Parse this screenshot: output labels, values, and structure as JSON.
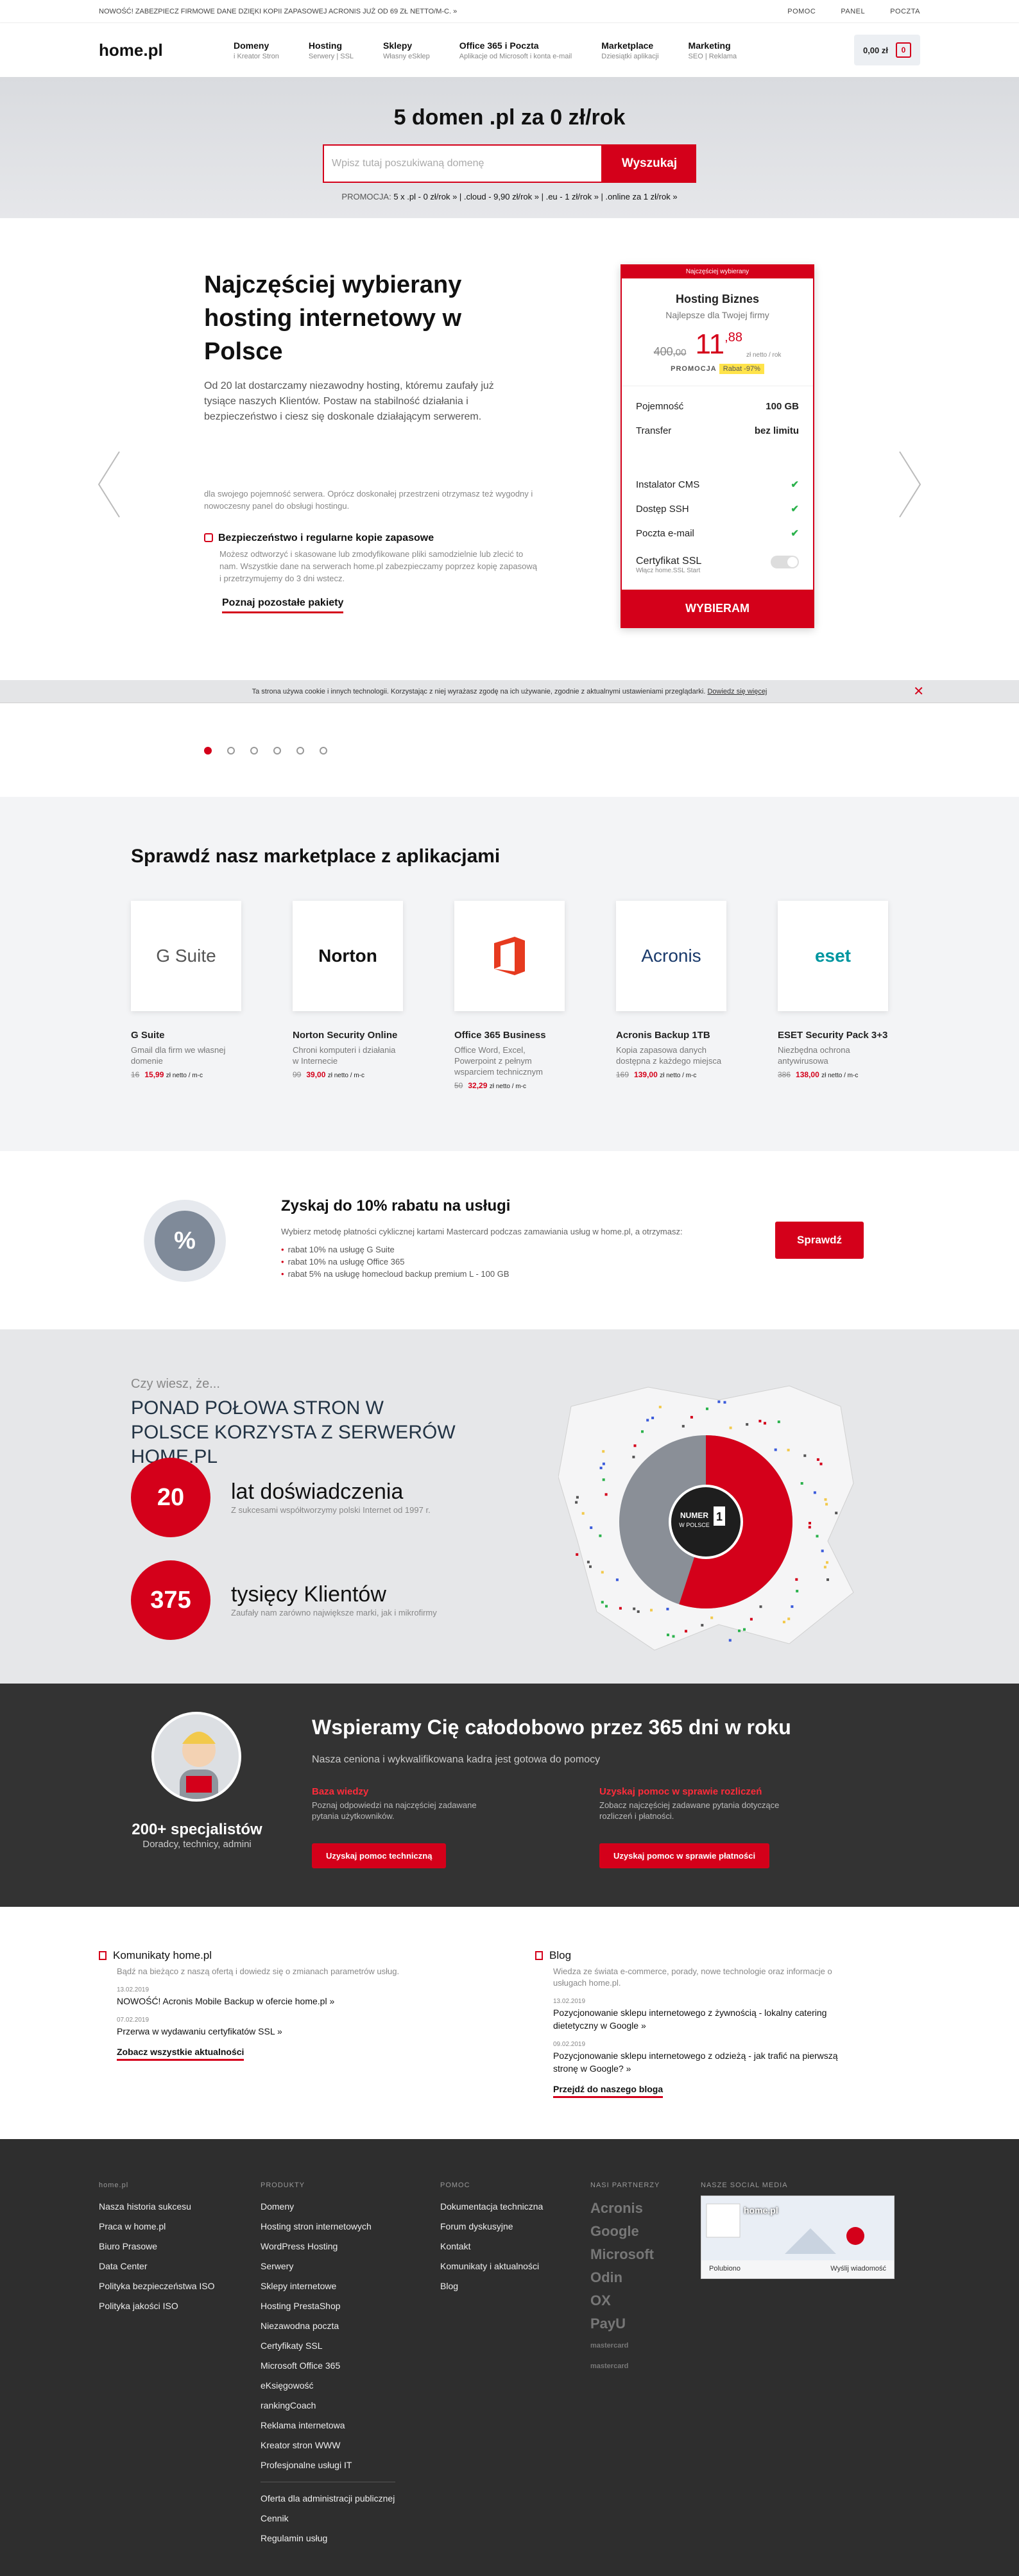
{
  "topbar": {
    "notice": "NOWOŚĆ! ZABEZPIECZ FIRMOWE DANE DZIĘKI KOPII ZAPASOWEJ ACRONIS JUŻ OD 69 ZŁ NETTO/M-C. »",
    "links": [
      "POMOC",
      "PANEL",
      "POCZTA"
    ]
  },
  "header": {
    "logo": "home.pl",
    "nav": [
      {
        "title": "Domeny",
        "sub": "i Kreator Stron"
      },
      {
        "title": "Hosting",
        "sub": "Serwery | SSL"
      },
      {
        "title": "Sklepy",
        "sub": "Własny eSklep"
      },
      {
        "title": "Office 365 i Poczta",
        "sub": "Aplikacje od Microsoft i konta e-mail"
      },
      {
        "title": "Marketplace",
        "sub": "Dziesiątki aplikacji"
      },
      {
        "title": "Marketing",
        "sub": "SEO | Reklama"
      }
    ],
    "cart": "0,00 zł",
    "cart_count": "0"
  },
  "hero": {
    "title": "5 domen .pl za 0 zł/rok",
    "placeholder": "Wpisz tutaj poszukiwaną domenę",
    "button": "Wyszukaj",
    "promo_label": "PROMOCJA:",
    "promo": "5 x .pl - 0 zł/rok » | .cloud - 9,90 zł/rok » | .eu - 1 zł/rok » | .online za 1 zł/rok »"
  },
  "hosting": {
    "title": "Najczęściej wybierany hosting internetowy w Polsce",
    "lead": "Od 20 lat dostarczamy niezawodny hosting, któremu zaufały już tysiące naszych Klientów. Postaw na stabilność działania i bezpieczeństwo i ciesz się doskonale działającym serwerem.",
    "feature1_desc": "dla swojego pojemność serwera. Oprócz doskonałej przestrzeni otrzymasz też wygodny i nowoczesny panel do obsługi hostingu.",
    "feature2_title": "Bezpieczeństwo i regularne kopie zapasowe",
    "feature2_desc": "Możesz odtworzyć i skasowane lub zmodyfikowane pliki samodzielnie lub zlecić to nam. Wszystkie dane na serwerach home.pl zabezpieczamy poprzez kopię zapasową i przetrzymujemy do 3 dni wstecz.",
    "more": "Poznaj pozostałe pakiety",
    "card": {
      "badge": "Najczęściej wybierany",
      "name": "Hosting Biznes",
      "sub": "Najlepsze dla Twojej firmy",
      "old": "400",
      "old_cents": ",00",
      "new": "11",
      "new_cents": ",88",
      "per": "zł netto / rok",
      "promo_label": "PROMOCJA",
      "promo": "Rabat -97%",
      "rows": [
        {
          "label": "Pojemność",
          "value": "100 GB"
        },
        {
          "label": "Transfer",
          "value": "bez limitu"
        }
      ],
      "checks": [
        "Instalator CMS",
        "Dostęp SSH",
        "Poczta e-mail"
      ],
      "check_mark": "✔",
      "ssl": "Certyfikat SSL",
      "ssl_sub": "Włącz home.SSL Start",
      "button": "WYBIERAM"
    }
  },
  "cookie": {
    "text": "Ta strona używa cookie i innych technologii. Korzystając z niej wyrażasz zgodę na ich używanie, zgodnie z aktualnymi ustawieniami przeglądarki.",
    "link": "Dowiedz się więcej",
    "close": "✕"
  },
  "slider": {
    "active": 1,
    "total": 6
  },
  "marketplace": {
    "title": "Sprawdź nasz marketplace z aplikacjami",
    "apps": [
      {
        "logo": "G Suite",
        "name": "G Suite",
        "desc": "Gmail dla firm we własnej domenie",
        "old": "16",
        "new": "15",
        "new_cents": ",99"
      },
      {
        "logo": "Norton",
        "name": "Norton Security Online",
        "desc": "Chroni komputeri i działania w Internecie",
        "old": "99",
        "new": "39",
        "new_cents": ",00"
      },
      {
        "logo": "Office",
        "name": "Office 365 Business",
        "desc": "Office Word, Excel, Powerpoint z pełnym wsparciem technicznym",
        "old": "50",
        "new": "32",
        "new_cents": ",29"
      },
      {
        "logo": "Acronis",
        "name": "Acronis Backup 1TB",
        "desc": "Kopia zapasowa danych dostępna z każdego miejsca",
        "old": "169",
        "new": "139",
        "new_cents": ",00"
      },
      {
        "logo": "eset",
        "name": "ESET Security Pack 3+3",
        "desc": "Niezbędna ochrona antywirusowa",
        "old": "386",
        "new": "138",
        "new_cents": ",00"
      }
    ],
    "per": "zł netto / m-c"
  },
  "discount": {
    "icon": "%",
    "title": "Zyskaj do 10% rabatu na usługi",
    "lead": "Wybierz metodę płatności cyklicznej kartami Mastercard podczas zamawiania usług w home.pl, a otrzymasz:",
    "items": [
      "rabat 10% na usługę G Suite",
      "rabat 10% na usługę Office 365",
      "rabat 5% na usługę homecloud backup premium L - 100 GB"
    ],
    "button": "Sprawdź"
  },
  "facts": {
    "q": "Czy wiesz, że...",
    "title": "PONAD POŁOWA STRON W POLSCE KORZYSTA Z SERWERÓW HOME.PL",
    "stats": [
      {
        "num": "20",
        "label": "lat doświadczenia",
        "desc": "Z sukcesami współtworzymy polski Internet od 1997 r."
      },
      {
        "num": "375",
        "label": "tysięcy Klientów",
        "desc": "Zaufały nam zarówno największe marki, jak i mikrofirmy"
      }
    ],
    "badge_l1": "NUMER",
    "badge_l2": "W POLSCE",
    "badge_num": "1",
    "share": 0.55
  },
  "support": {
    "count": "200+ specjalistów",
    "count_sub": "Doradcy, technicy, admini",
    "title": "Wspieramy Cię całodobowo przez 365 dni w roku",
    "lead": "Nasza ceniona i wykwalifikowana kadra jest gotowa do pomocy",
    "cols": [
      {
        "h": "Baza wiedzy",
        "d": "Poznaj odpowiedzi na najczęściej zadawane pytania użytkowników.",
        "btn": "Uzyskaj pomoc techniczną"
      },
      {
        "h": "Uzyskaj pomoc w sprawie rozliczeń",
        "d": "Zobacz najczęściej zadawane pytania dotyczące rozliczeń i płatności.",
        "btn": "Uzyskaj pomoc w sprawie płatności"
      }
    ]
  },
  "news": {
    "h": "Komunikaty home.pl",
    "d": "Bądź na bieżąco z naszą ofertą i dowiedz się o zmianach parametrów usług.",
    "items": [
      {
        "date": "13.02.2019",
        "title": "NOWOŚĆ! Acronis Mobile Backup w ofercie home.pl »"
      },
      {
        "date": "07.02.2019",
        "title": "Przerwa w wydawaniu certyfikatów SSL »"
      }
    ],
    "more": "Zobacz wszystkie aktualności"
  },
  "blog": {
    "h": "Blog",
    "d": "Wiedza ze świata e-commerce, porady, nowe technologie oraz informacje o usługach home.pl.",
    "items": [
      {
        "date": "13.02.2019",
        "title": "Pozycjonowanie sklepu internetowego z żywnością - lokalny catering dietetyczny w Google »"
      },
      {
        "date": "09.02.2019",
        "title": "Pozycjonowanie sklepu internetowego z odzieżą - jak trafić na pierwszą stronę w Google? »"
      }
    ],
    "more": "Przejdź do naszego bloga"
  },
  "footer": {
    "col1": {
      "h": "home.pl",
      "links": [
        "Nasza historia sukcesu",
        "Praca w home.pl",
        "Biuro Prasowe",
        "Data Center",
        "Polityka bezpieczeństwa ISO",
        "Polityka jakości ISO"
      ]
    },
    "col2": {
      "h": "PRODUKTY",
      "links": [
        "Domeny",
        "Hosting stron internetowych",
        "WordPress Hosting",
        "Serwery",
        "Sklepy internetowe",
        "Hosting PrestaShop",
        "Niezawodna poczta",
        "Certyfikaty SSL",
        "Microsoft Office 365",
        "eKsięgowość",
        "rankingCoach",
        "Reklama internetowa",
        "Kreator stron WWW",
        "Profesjonalne usługi IT"
      ],
      "extra": [
        "Oferta dla administracji publicznej",
        "Cennik",
        "Regulamin usług"
      ]
    },
    "col3": {
      "h": "POMOC",
      "links": [
        "Dokumentacja techniczna",
        "Forum dyskusyjne",
        "Kontakt",
        "Komunikaty i aktualności",
        "Blog"
      ]
    },
    "col4": {
      "h": "NASI PARTNERZY",
      "partners": [
        "Acronis",
        "Google",
        "Microsoft",
        "Odin",
        "OX",
        "PayU",
        "mastercard",
        "mastercard"
      ]
    },
    "col5": {
      "h": "NASZE SOCIAL MEDIA",
      "page": "home.pl",
      "likes": "Polubiono",
      "msg": "Wyślij wiadomość"
    }
  }
}
